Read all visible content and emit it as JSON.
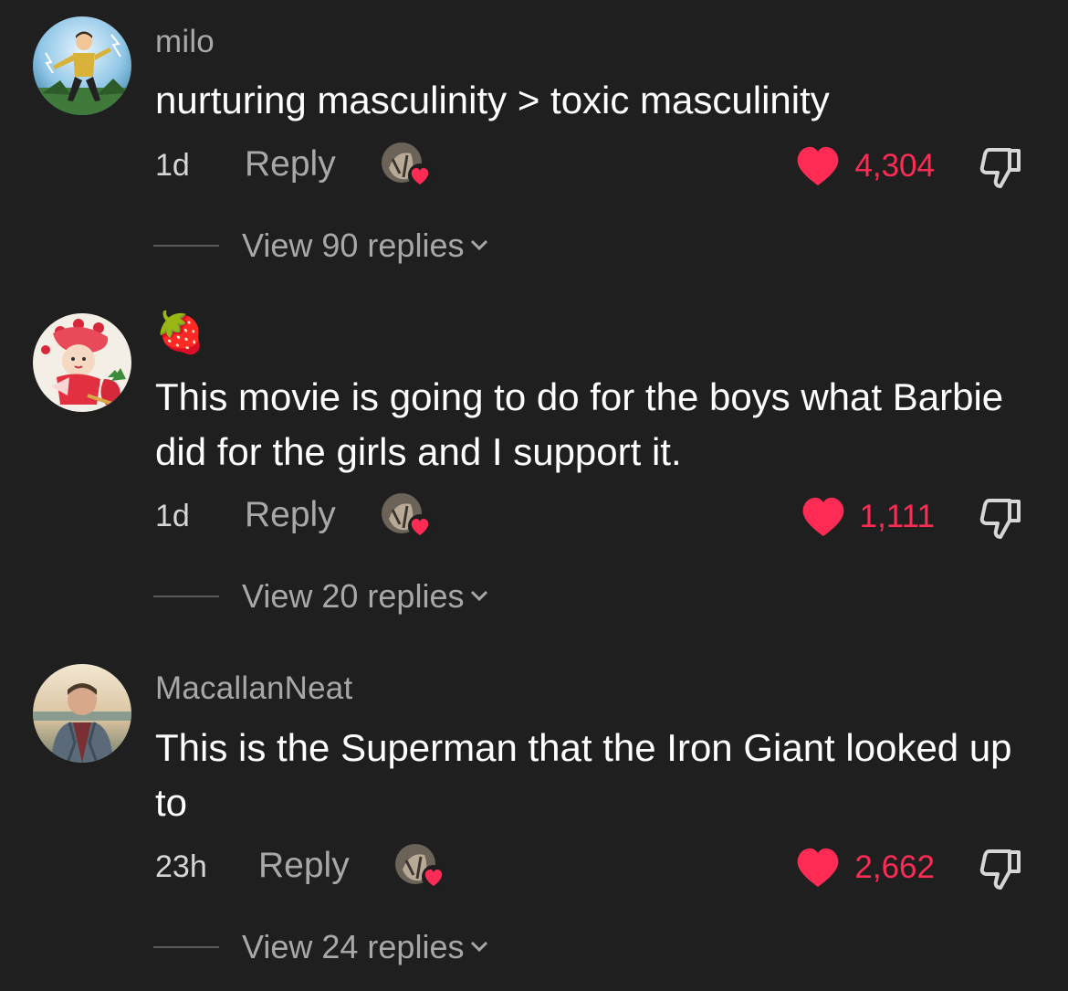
{
  "comments": [
    {
      "username": "milo",
      "text": "nurturing masculinity > toxic masculinity",
      "time": "1d",
      "reply_label": "Reply",
      "likes": "4,304",
      "view_replies": "View 90 replies"
    },
    {
      "username": "🍓",
      "text": "This movie is going to do for the boys what Barbie did for the girls and I support it.",
      "time": "1d",
      "reply_label": "Reply",
      "likes": "1,111",
      "view_replies": "View 20 replies"
    },
    {
      "username": "MacallanNeat",
      "text": "This is the Superman that the Iron Giant looked up to",
      "time": "23h",
      "reply_label": "Reply",
      "likes": "2,662",
      "view_replies": "View 24 replies"
    }
  ],
  "colors": {
    "background": "#1f1f1f",
    "like_red": "#fe2c55",
    "secondary_text": "#a8a8a8"
  },
  "icons": {
    "like": "heart-icon",
    "dislike": "thumbs-down-icon",
    "expand": "chevron-down-icon",
    "creator_liked": "creator-liked-avatar-icon"
  }
}
